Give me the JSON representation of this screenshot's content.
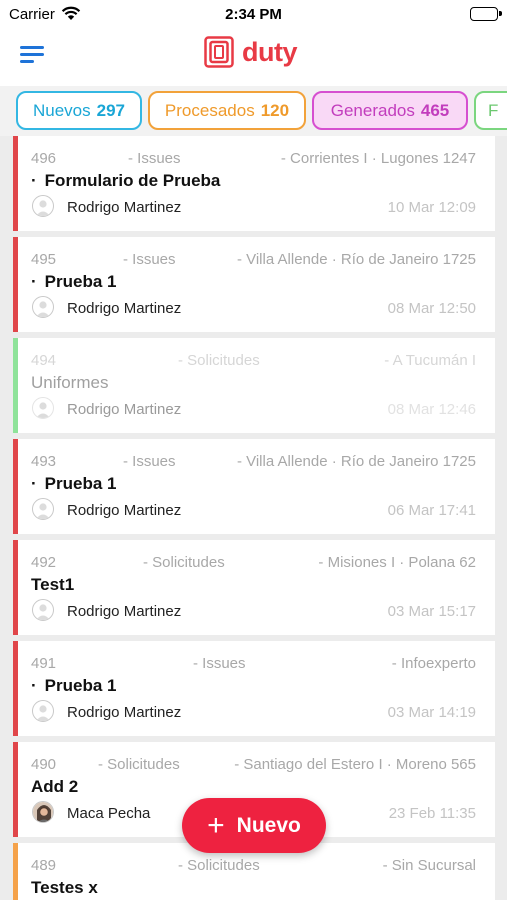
{
  "status_bar": {
    "carrier": "Carrier",
    "time": "2:34 PM"
  },
  "brand": {
    "name": "duty",
    "color": "#e83a45"
  },
  "icons": {
    "menu": "hamburger-menu-icon",
    "wifi": "wifi-icon",
    "battery": "battery-icon",
    "logo": "duty-logo-icon",
    "avatar": "user-avatar-icon",
    "fab": "plus-icon"
  },
  "filters": [
    {
      "label": "Nuevos",
      "count": "297",
      "color": "#33b7e3"
    },
    {
      "label": "Procesados",
      "count": "120",
      "color": "#f2a23a"
    },
    {
      "label": "Generados",
      "count": "465",
      "color": "#d64fd0",
      "selected": true
    },
    {
      "label": "F",
      "count": "",
      "color": "#7bd67f"
    }
  ],
  "tickets": [
    {
      "number": "496",
      "category": "- Issues",
      "location": "- Corrientes I · Lugones 1247",
      "bullet": "·",
      "title": "Formulario de Prueba",
      "user": "Rodrigo Martinez",
      "date": "10 Mar 12:09",
      "accent": "#e0464a"
    },
    {
      "number": "495",
      "category": "- Issues",
      "location": "- Villa Allende · Río de Janeiro 1725",
      "bullet": "·",
      "title": "Prueba 1",
      "user": "Rodrigo Martinez",
      "date": "08 Mar 12:50",
      "accent": "#e0464a"
    },
    {
      "number": "494",
      "category": "- Solicitudes",
      "location": "- A Tucumán I",
      "bullet": "",
      "title": "Uniformes",
      "user": "Rodrigo Martinez",
      "date": "08 Mar 12:46",
      "accent": "#8fe39a",
      "faded": true
    },
    {
      "number": "493",
      "category": "- Issues",
      "location": "- Villa Allende · Río de Janeiro 1725",
      "bullet": "·",
      "title": "Prueba 1",
      "user": "Rodrigo Martinez",
      "date": "06 Mar 17:41",
      "accent": "#e0464a"
    },
    {
      "number": "492",
      "category": "- Solicitudes",
      "location": "- Misiones I · Polana 62",
      "bullet": "",
      "title": "Test1",
      "user": "Rodrigo Martinez",
      "date": "03 Mar 15:17",
      "accent": "#e0464a"
    },
    {
      "number": "491",
      "category": "- Issues",
      "location": "- Infoexperto",
      "bullet": "·",
      "title": "Prueba 1",
      "user": "Rodrigo Martinez",
      "date": "03 Mar 14:19",
      "accent": "#e0464a"
    },
    {
      "number": "490",
      "category": "- Solicitudes",
      "location": "- Santiago del Estero I · Moreno 565",
      "bullet": "",
      "title": "Add 2",
      "user": "Maca Pecha",
      "date": "23 Feb 11:35",
      "accent": "#e0464a",
      "photo": true
    },
    {
      "number": "489",
      "category": "- Solicitudes",
      "location": "- Sin Sucursal",
      "bullet": "",
      "title": "Testes x",
      "user": "",
      "date": "",
      "accent": "#f5a24a"
    }
  ],
  "fab": {
    "label": "Nuevo",
    "symbol": "+"
  }
}
